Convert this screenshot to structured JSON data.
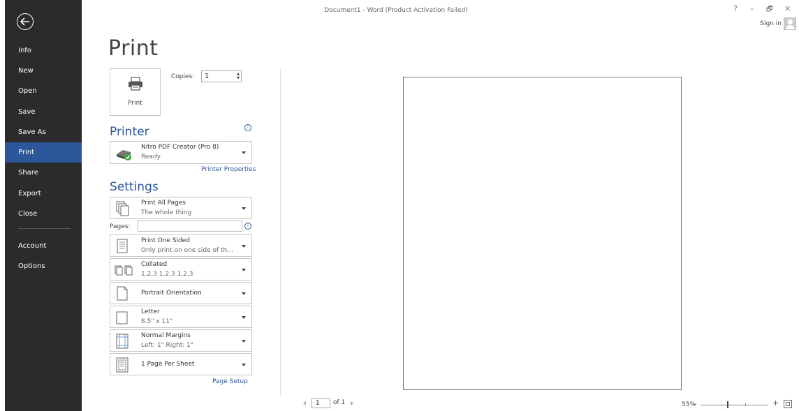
{
  "window": {
    "title": "Document1 - Word (Product Activation Failed)",
    "help": "?",
    "minimize": "–",
    "restore": "🗗",
    "close": "✕",
    "sign_in": "Sign in"
  },
  "sidebar": {
    "items": [
      {
        "label": "Info"
      },
      {
        "label": "New"
      },
      {
        "label": "Open"
      },
      {
        "label": "Save"
      },
      {
        "label": "Save As"
      },
      {
        "label": "Print",
        "active": true
      },
      {
        "label": "Share"
      },
      {
        "label": "Export"
      },
      {
        "label": "Close"
      },
      {
        "label": "Account"
      },
      {
        "label": "Options"
      }
    ]
  },
  "main": {
    "title": "Print",
    "print_button": "Print",
    "copies_label": "Copies:",
    "copies_value": "1",
    "printer_heading": "Printer",
    "printer": {
      "name": "Nitro PDF Creator (Pro 8)",
      "status": "Ready"
    },
    "printer_properties": "Printer Properties",
    "settings_heading": "Settings",
    "settings": [
      {
        "line1": "Print All Pages",
        "line2": "The whole thing",
        "icon": "pages-icon"
      },
      {
        "line1": "Print One Sided",
        "line2": "Only print on one side of th...",
        "icon": "one-sided-icon"
      },
      {
        "line1": "Collated",
        "line2": "1,2,3   1,2,3   1,2,3",
        "icon": "collated-icon"
      },
      {
        "line1": "Portrait Orientation",
        "line2": "",
        "icon": "portrait-icon"
      },
      {
        "line1": "Letter",
        "line2": "8.5\" x 11\"",
        "icon": "paper-size-icon"
      },
      {
        "line1": "Normal Margins",
        "line2": "Left: 1\"   Right: 1\"",
        "icon": "margins-icon"
      },
      {
        "line1": "1 Page Per Sheet",
        "line2": "",
        "icon": "pages-per-sheet-icon"
      }
    ],
    "pages_label": "Pages:",
    "pages_value": "",
    "page_setup": "Page Setup"
  },
  "preview": {
    "current_page": "1",
    "of_pages": "of 1",
    "zoom": "55%",
    "zoom_level_percent": 55
  },
  "colors": {
    "accent": "#2b579a",
    "sidebar_bg": "#2b2b2b"
  }
}
